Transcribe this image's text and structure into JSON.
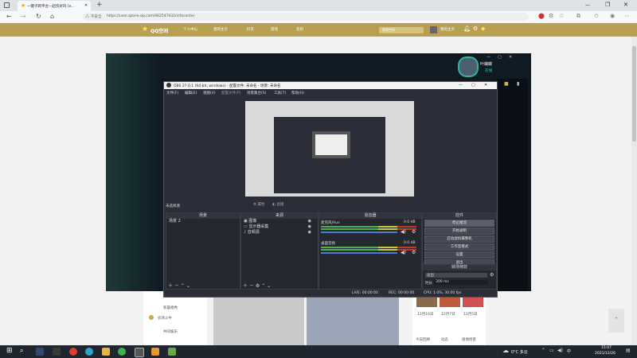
{
  "browser": {
    "tab_title": "一键子跨平台—起伤好吗 [e...",
    "new_tab": "+",
    "security_label": "不安全",
    "url": "https://user.qzone.qq.com/962547432/infocenter",
    "window_controls": [
      "—",
      "❐",
      "✕"
    ]
  },
  "qzone": {
    "logo": "QQ空间",
    "nav": [
      "个人中心",
      "我的主页",
      "好友",
      "游戏",
      "装扮"
    ],
    "search_placeholder": "搜索空间",
    "username": "我的主页",
    "left_links": [
      "新晨相秀",
      "农场斗牛",
      "共同娱乐"
    ],
    "dates": [
      "12月16日",
      "12月7日",
      "12月5日"
    ],
    "bottom_links": [
      "今日回顾",
      "动态",
      "谢谢修客"
    ],
    "profile_name": "叶蝴蝶",
    "profile_status": "在线"
  },
  "obs": {
    "title": "OBS 27.0.1 (64-bit, windows) - 配置文件: 未命名 - 场景: 未命名",
    "menu": [
      "文件(F)",
      "编辑(E)",
      "视图(V)",
      "配置文件(P)",
      "场景集合(S)",
      "工具(T)",
      "帮助(H)"
    ],
    "preview_label": "未选择源",
    "filter_btn": "属性",
    "filter_btn2": "滤镜",
    "scenes_header": "场景",
    "scenes": [
      "场景 2"
    ],
    "sources_header": "来源",
    "sources": [
      "图像",
      "显示器采集",
      "音频源"
    ],
    "mixer_header": "混音器",
    "mixer": [
      {
        "name": "麦克风/Aux",
        "db": "0.0 dB",
        "level": 0.45
      },
      {
        "name": "桌面音频",
        "db": "0.0 dB",
        "level": 0.35
      }
    ],
    "controls_header": "控件",
    "controls": [
      "停止推流",
      "开始录制",
      "启动虚拟摄像机",
      "工作室模式",
      "设置",
      "退出"
    ],
    "transitions_header": "转场特效",
    "transition": "淡出",
    "duration_label": "时长",
    "duration_value": "300 ms",
    "status": [
      "LIVE: 00:00:00",
      "REC: 00:00:00",
      "CPU: 1.0%, 30.00 fps"
    ]
  },
  "taskbar": {
    "weather": "0°C 多云",
    "time": "15:07",
    "date": "2021/12/26",
    "ime": "中",
    "apps": [
      "start-icon",
      "search-icon",
      "steam-icon",
      "console-icon",
      "chrome-icon",
      "edge-icon",
      "files-icon",
      "wechat-icon",
      "obs-icon",
      "notes-icon",
      "box-icon",
      "app-icon"
    ]
  },
  "colors": {
    "qzone_nav": "#b9a050",
    "obs_bg": "#2b2e38",
    "meter_green": "#4caf50",
    "meter_yellow": "#c9c63c",
    "meter_red": "#c0392b"
  }
}
